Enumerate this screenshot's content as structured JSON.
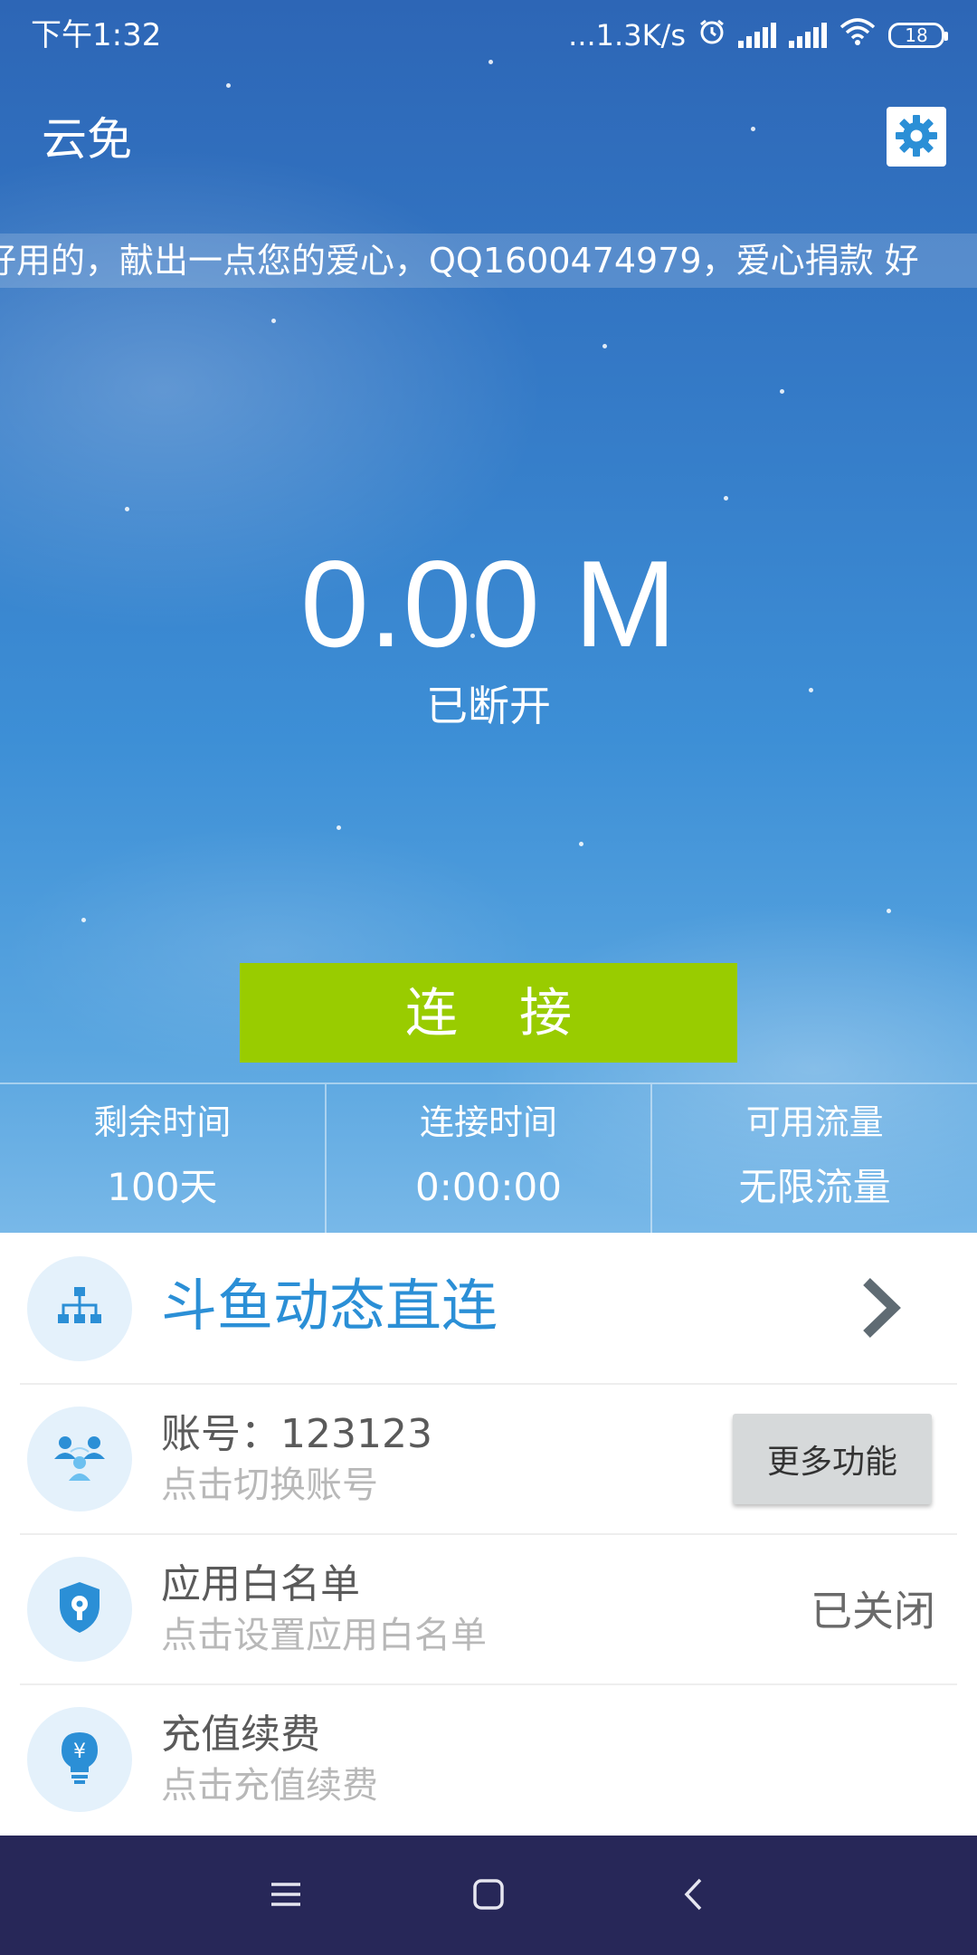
{
  "status_bar": {
    "time": "下午1:32",
    "network_speed": "...1.3K/s",
    "battery_level": "18"
  },
  "header": {
    "title": "云免",
    "settings_icon": "gear-icon"
  },
  "marquee": {
    "text": "好用的，献出一点您的爱心，QQ1600474979，爱心捐款 好"
  },
  "connection": {
    "speed": "0.00 M",
    "status": "已断开",
    "connect_label": "连 接"
  },
  "stats": [
    {
      "label": "剩余时间",
      "value": "100天"
    },
    {
      "label": "连接时间",
      "value": "0:00:00"
    },
    {
      "label": "可用流量",
      "value": "无限流量"
    }
  ],
  "list": {
    "douyu": {
      "title": "斗鱼动态直连",
      "icon": "network-icon"
    },
    "account": {
      "title": "账号：123123",
      "subtitle": "点击切换账号",
      "button": "更多功能",
      "icon": "users-icon"
    },
    "whitelist": {
      "title": "应用白名单",
      "subtitle": "点击设置应用白名单",
      "state": "已关闭",
      "icon": "shield-icon"
    },
    "recharge": {
      "title": "充值续费",
      "subtitle": "点击充值续费",
      "icon": "bulb-yen-icon"
    }
  },
  "colors": {
    "accent_green": "#99cc00",
    "accent_blue": "#2b8fd6",
    "navbar": "#272758"
  }
}
